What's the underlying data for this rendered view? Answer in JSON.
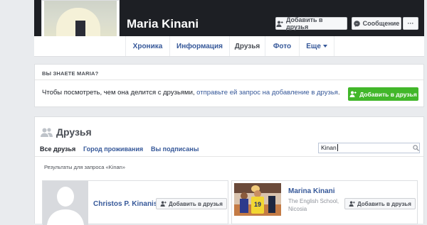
{
  "profile": {
    "name": "Maria Kinani",
    "add_friend_label": "Добавить в друзья",
    "message_label": "Сообщение",
    "more_label": "···"
  },
  "nav": {
    "tabs": [
      {
        "label": "Хроника"
      },
      {
        "label": "Информация"
      },
      {
        "label": "Друзья"
      },
      {
        "label": "Фото"
      },
      {
        "label": "Еще"
      }
    ]
  },
  "know": {
    "title": "ВЫ ЗНАЕТЕ MARIA?",
    "text": "Чтобы посмотреть, чем она делится с друзьями, ",
    "link": "отправьте ей запрос на добавление в друзья",
    "text_end": ".",
    "button_label": "Добавить в друзья"
  },
  "friends": {
    "title": "Друзья",
    "tabs": [
      {
        "label": "Все друзья"
      },
      {
        "label": "Город проживания"
      },
      {
        "label": "Вы подписаны"
      }
    ],
    "search_value": "Kinan",
    "results_label": "Результаты для запроса «Kinan»",
    "cards": [
      {
        "name": "Christos P. Kinanis",
        "button_label": "Добавить в друзья"
      },
      {
        "name": "Marina Kinani",
        "school": "The English School, Nicosia",
        "jersey": "19",
        "button_label": "Добавить в друзья"
      }
    ]
  },
  "colors": {
    "accent": "#365899",
    "green": "#42b72a",
    "cover": "#1d1f24",
    "background": "#e9ebee"
  }
}
